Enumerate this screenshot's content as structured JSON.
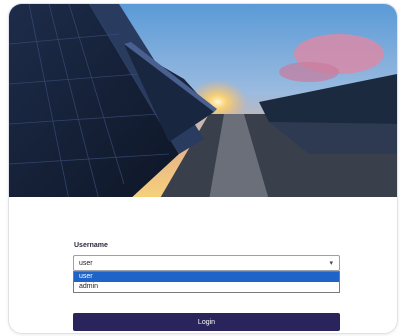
{
  "form": {
    "username_label": "Username",
    "selected_value": "user",
    "options": [
      "user",
      "admin"
    ],
    "login_label": "Login"
  },
  "icons": {
    "dropdown": "chevron-down-icon"
  },
  "colors": {
    "login_button": "#29245c",
    "selected_option": "#1e64c8"
  }
}
